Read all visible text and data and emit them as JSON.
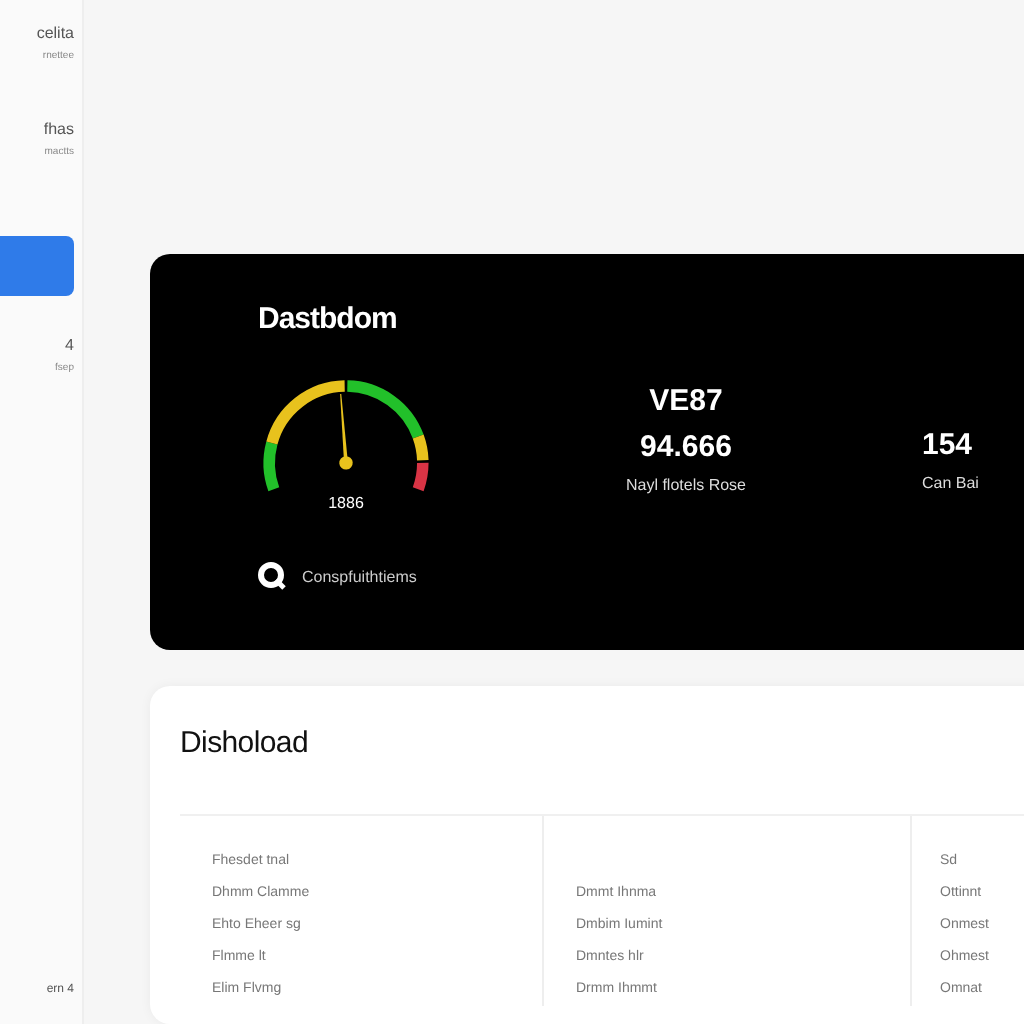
{
  "sidebar": {
    "items": [
      {
        "label": "celita",
        "sublabel": "rnettee",
        "selected": false
      },
      {
        "label": "fhas",
        "sublabel": "mactts",
        "selected": false
      },
      {
        "selected": true
      },
      {
        "label": "4",
        "sublabel": "fsep",
        "selected": false
      }
    ],
    "footer": "ern 4"
  },
  "hero": {
    "title": "Dastbdom",
    "gauge": {
      "level": 0.48,
      "reading": "1886"
    },
    "stats": [
      {
        "label": "VE87",
        "value": "94.666",
        "caption": "Nayl flotels Rose"
      },
      {
        "value": "154",
        "caption": "Can Bai"
      }
    ],
    "footer": "Conspfuithtiems"
  },
  "panel": {
    "title": "Dishoload",
    "rows": [
      {
        "column_1": "Fhesdet tnal",
        "column_3": "Sd"
      },
      {
        "column_1": "Dhmm Clamme",
        "column_2": "Dmmt Ihnma",
        "column_3": "Ottinnt"
      },
      {
        "column_1": "Ehto Eheer  sg",
        "column_2": "Dmbim Iumint",
        "column_3": "Onmest"
      },
      {
        "column_1": "Flmme lt",
        "column_2": "Dmntes hlr",
        "column_3": "Ohmest"
      },
      {
        "column_1": "Elim Flvmg",
        "column_2": "Drmm Ihmmt",
        "column_3": "Omnat"
      }
    ]
  }
}
